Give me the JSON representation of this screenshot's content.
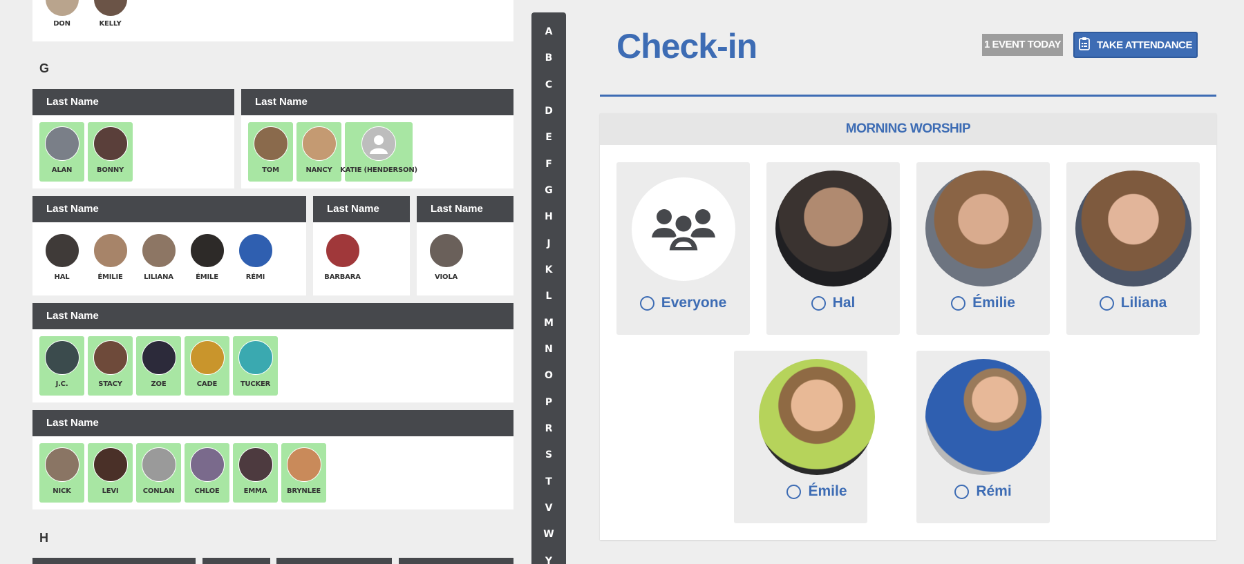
{
  "directory": {
    "top_card": {
      "members": [
        "DON",
        "KELLY"
      ]
    },
    "sections": [
      {
        "letter": "G"
      },
      {
        "letter": "H"
      }
    ],
    "families": [
      {
        "header": "Last Name",
        "members": [
          {
            "name": "ALAN",
            "checked": true
          },
          {
            "name": "BONNY",
            "checked": true
          }
        ]
      },
      {
        "header": "Last Name",
        "members": [
          {
            "name": "TOM",
            "checked": true
          },
          {
            "name": "NANCY",
            "checked": true
          },
          {
            "name": "KATIE (HENDERSON)",
            "checked": true
          }
        ]
      },
      {
        "header": "Last Name",
        "members": [
          {
            "name": "HAL",
            "checked": false
          },
          {
            "name": "ÉMILIE",
            "checked": false
          },
          {
            "name": "LILIANA",
            "checked": false
          },
          {
            "name": "ÉMILE",
            "checked": false
          },
          {
            "name": "RÉMI",
            "checked": false
          }
        ]
      },
      {
        "header": "Last Name",
        "members": [
          {
            "name": "BARBARA",
            "checked": false
          }
        ]
      },
      {
        "header": "Last Name",
        "members": [
          {
            "name": "VIOLA",
            "checked": false
          }
        ]
      },
      {
        "header": "Last Name",
        "members": [
          {
            "name": "J.C.",
            "checked": true
          },
          {
            "name": "STACY",
            "checked": true
          },
          {
            "name": "ZOE",
            "checked": true
          },
          {
            "name": "CADE",
            "checked": true
          },
          {
            "name": "TUCKER",
            "checked": true
          }
        ]
      },
      {
        "header": "Last Name",
        "members": [
          {
            "name": "NICK",
            "checked": true
          },
          {
            "name": "LEVI",
            "checked": true
          },
          {
            "name": "CONLAN",
            "checked": true
          },
          {
            "name": "CHLOE",
            "checked": true
          },
          {
            "name": "EMMA",
            "checked": true
          },
          {
            "name": "BRYNLEE",
            "checked": true
          }
        ]
      }
    ]
  },
  "alphabet": [
    "A",
    "B",
    "C",
    "D",
    "E",
    "F",
    "G",
    "H",
    "J",
    "K",
    "L",
    "M",
    "N",
    "O",
    "P",
    "R",
    "S",
    "T",
    "V",
    "W",
    "Y"
  ],
  "checkin": {
    "title": "Check-in",
    "events_badge": "1 EVENT TODAY",
    "take_attendance": "TAKE ATTENDANCE",
    "event_name": "MORNING WORSHIP",
    "people": [
      "Everyone",
      "Hal",
      "Émilie",
      "Liliana",
      "Émile",
      "Rémi"
    ]
  },
  "colors": {
    "accent": "#3d6cb4",
    "checked": "#a8e6a3",
    "header_dark": "#46484c"
  }
}
